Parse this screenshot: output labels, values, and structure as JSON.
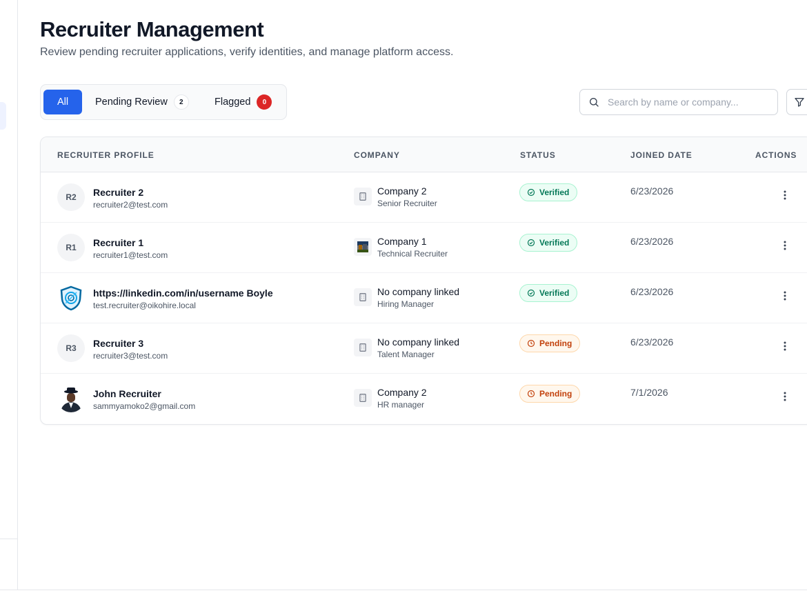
{
  "header": {
    "title": "Recruiter Management",
    "subtitle": "Review pending recruiter applications, verify identities, and manage platform access."
  },
  "tabs": [
    {
      "label": "All",
      "active": true
    },
    {
      "label": "Pending Review",
      "count": "2"
    },
    {
      "label": "Flagged",
      "count": "0"
    }
  ],
  "search": {
    "placeholder": "Search by name or company..."
  },
  "table": {
    "columns": [
      "RECRUITER PROFILE",
      "COMPANY",
      "STATUS",
      "JOINED DATE",
      "ACTIONS"
    ],
    "rows": [
      {
        "initials": "R2",
        "name": "Recruiter 2",
        "email": "recruiter2@test.com",
        "company": "Company 2",
        "role": "Senior Recruiter",
        "status": "Verified",
        "joined": "6/23/2026"
      },
      {
        "initials": "R1",
        "name": "Recruiter 1",
        "email": "recruiter1@test.com",
        "company": "Company 1",
        "role": "Technical Recruiter",
        "status": "Verified",
        "joined": "6/23/2026"
      },
      {
        "initials": "",
        "name": "https://linkedin.com/in/username Boyle",
        "email": "test.recruiter@oikohire.local",
        "company": "No company linked",
        "role": "Hiring Manager",
        "status": "Verified",
        "joined": "6/23/2026"
      },
      {
        "initials": "R3",
        "name": "Recruiter 3",
        "email": "recruiter3@test.com",
        "company": "No company linked",
        "role": "Talent Manager",
        "status": "Pending",
        "joined": "6/23/2026"
      },
      {
        "initials": "",
        "name": "John Recruiter",
        "email": "sammyamoko2@gmail.com",
        "company": "Company 2",
        "role": "HR manager",
        "status": "Pending",
        "joined": "7/1/2026"
      }
    ]
  },
  "colors": {
    "accent": "#2563eb",
    "flagged_badge": "#dc2626",
    "verified_text": "#047857",
    "pending_text": "#c2410c"
  },
  "icons": {
    "search": "search-icon",
    "filter": "filter-icon",
    "company": "building-icon",
    "verified": "check-circle-icon",
    "pending": "clock-icon",
    "actions": "more-vertical-icon"
  }
}
